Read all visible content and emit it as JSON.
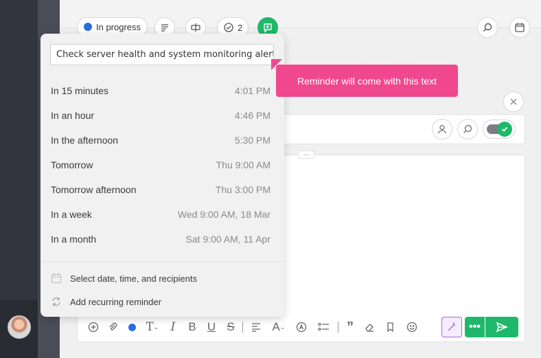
{
  "header": {
    "status_label": "In progress",
    "check_count": "2"
  },
  "reminder": {
    "text_value": "Check server health and system monitoring alerts.",
    "tooltip": "Reminder will come with this text",
    "options": [
      {
        "label": "In 15 minutes",
        "time": "4:01 PM"
      },
      {
        "label": "In an hour",
        "time": "4:46 PM"
      },
      {
        "label": "In the afternoon",
        "time": "5:30 PM"
      },
      {
        "label": "Tomorrow",
        "time": "Thu 9:00 AM"
      },
      {
        "label": "Tomorrow afternoon",
        "time": "Thu 3:00 PM"
      },
      {
        "label": "In a week",
        "time": "Wed 9:00 AM, 18 Mar"
      },
      {
        "label": "In a month",
        "time": "Sat 9:00 AM, 11 Apr"
      }
    ],
    "actions": {
      "custom": "Select date, time, and recipients",
      "recurring": "Add recurring reminder"
    }
  },
  "editor": {
    "drag_handle": "..."
  },
  "colors": {
    "accent_green": "#1fb86a",
    "tooltip_pink": "#f0488f",
    "status_blue": "#2d6cdf",
    "magic_purple": "#a366e6"
  },
  "icons": {
    "status": "status-dot-icon",
    "description": "lines-icon",
    "tag": "tag-icon",
    "checklist": "check-circle-icon",
    "comment": "chat-icon",
    "search": "search-icon",
    "calendar": "calendar-icon",
    "close": "close-icon",
    "assignee": "person-icon",
    "find": "search-icon",
    "confirm": "check-icon",
    "schedule": "calendar-icon",
    "recurring": "repeat-icon",
    "send": "send-icon",
    "magic": "magic-wand-icon",
    "more": "more-icon"
  }
}
